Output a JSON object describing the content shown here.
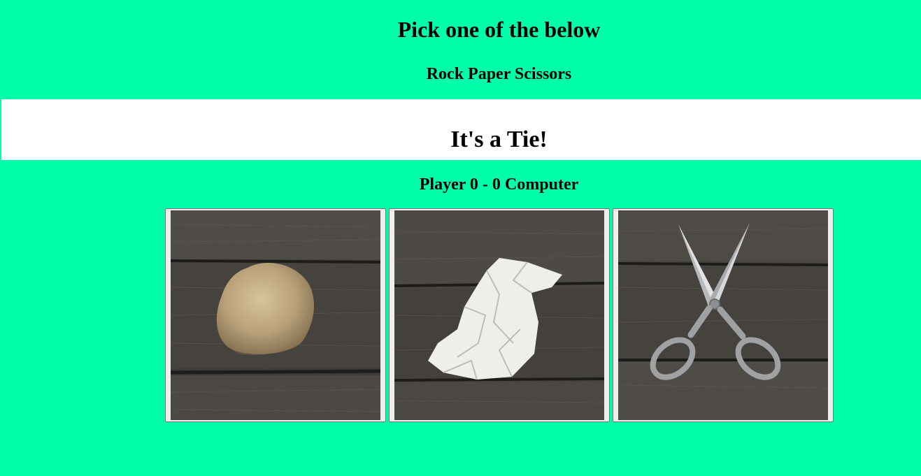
{
  "header": {
    "title": "Pick one of the below",
    "subtitle": "Rock Paper Scissors"
  },
  "result": {
    "message": "It's a Tie!"
  },
  "scoreboard": {
    "text": "Player 0 - 0 Computer"
  },
  "choices": [
    {
      "icon": "rock-image"
    },
    {
      "icon": "paper-image"
    },
    {
      "icon": "scissors-image"
    }
  ],
  "colors": {
    "background": "#00ffaa",
    "result_panel": "#ffffff",
    "wood_dark": "#3d3a37",
    "wood_light": "#5a5651"
  }
}
